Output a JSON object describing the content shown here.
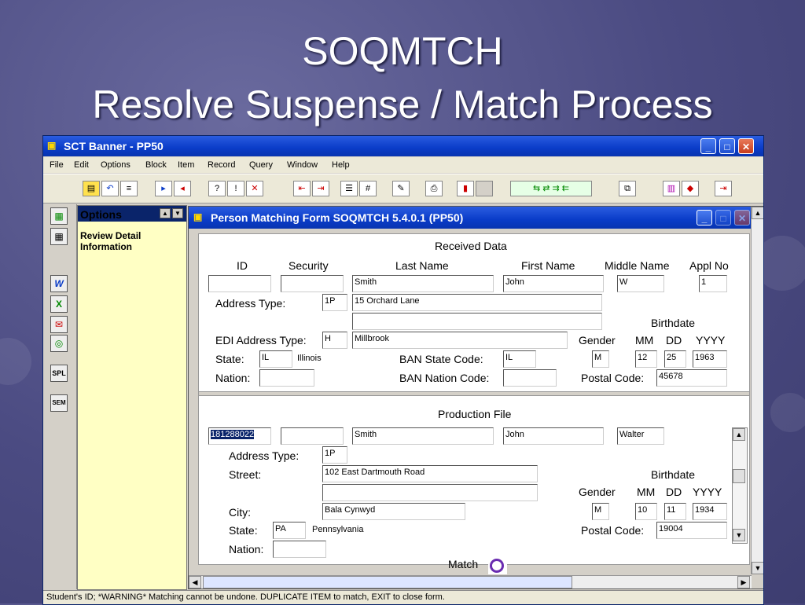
{
  "slide": {
    "title_line1": "SOQMTCH",
    "title_line2": "Resolve Suspense / Match Process"
  },
  "app": {
    "title": "SCT Banner - PP50",
    "menu": [
      "File",
      "Edit",
      "Options",
      "Block",
      "Item",
      "Record",
      "Query",
      "Window",
      "Help"
    ]
  },
  "options_panel": {
    "header": "Options",
    "item": "Review Detail Information"
  },
  "form": {
    "title": "Person Matching Form  SOQMTCH  5.4.0.1  (PP50)",
    "received": {
      "section_title": "Received Data",
      "col_id": "ID",
      "col_security": "Security",
      "col_last": "Last Name",
      "col_first": "First Name",
      "col_middle": "Middle Name",
      "col_appl": "Appl No",
      "id": "",
      "security": "",
      "last_name": "Smith",
      "first_name": "John",
      "middle_name": "W",
      "appl_no": "1",
      "address_type_label": "Address Type:",
      "address_type": "1P",
      "street1": "15 Orchard Lane",
      "street2": "",
      "edi_label": "EDI Address Type:",
      "edi_type": "H",
      "city": "Millbrook",
      "birthdate_label": "Birthdate",
      "gender_label": "Gender",
      "mm_label": "MM",
      "dd_label": "DD",
      "yyyy_label": "YYYY",
      "state_label": "State:",
      "state_code": "IL",
      "state_name": "Illinois",
      "ban_state_label": "BAN State Code:",
      "ban_state": "IL",
      "gender": "M",
      "mm": "12",
      "dd": "25",
      "yyyy": "1963",
      "nation_label": "Nation:",
      "nation": "",
      "ban_nation_label": "BAN Nation Code:",
      "ban_nation": "",
      "postal_label": "Postal Code:",
      "postal": "45678"
    },
    "production": {
      "section_title": "Production File",
      "id": "181288022",
      "security": "",
      "last_name": "Smith",
      "first_name": "John",
      "middle_name": "Walter",
      "address_type_label": "Address Type:",
      "address_type": "1P",
      "street_label": "Street:",
      "street1": "102 East Dartmouth Road",
      "street2": "",
      "birthdate_label": "Birthdate",
      "gender_label": "Gender",
      "mm_label": "MM",
      "dd_label": "DD",
      "yyyy_label": "YYYY",
      "city_label": "City:",
      "city": "Bala Cynwyd",
      "gender": "M",
      "mm": "10",
      "dd": "11",
      "yyyy": "1934",
      "state_label": "State:",
      "state_code": "PA",
      "state_name": "Pennsylvania",
      "postal_label": "Postal Code:",
      "postal": "19004",
      "nation_label": "Nation:",
      "nation": "",
      "match_label": "Match"
    }
  },
  "status_bar": {
    "message": "Student's ID; *WARNING* Matching cannot be undone. DUPLICATE ITEM to match, EXIT to close form."
  },
  "icons": [
    "save-icon",
    "rollback-icon",
    "print-icon",
    "insert-record-icon",
    "remove-record-icon",
    "enter-query-icon",
    "execute-query-icon",
    "cancel-query-icon",
    "previous-block-icon",
    "next-block-icon",
    "list-icon",
    "count-icon",
    "edit-icon",
    "print-doc-icon",
    "chart-icon",
    "help-icon",
    "exit-icon",
    "calculator-icon",
    "calendar-icon",
    "word-icon",
    "excel-icon",
    "mail-icon",
    "globe-icon",
    "spl-icon",
    "sem-icon",
    "match-icon"
  ],
  "colors": {
    "titlebar": "#0a3cc8",
    "options_bg": "#ffffc4",
    "background": "#4b4b82"
  }
}
